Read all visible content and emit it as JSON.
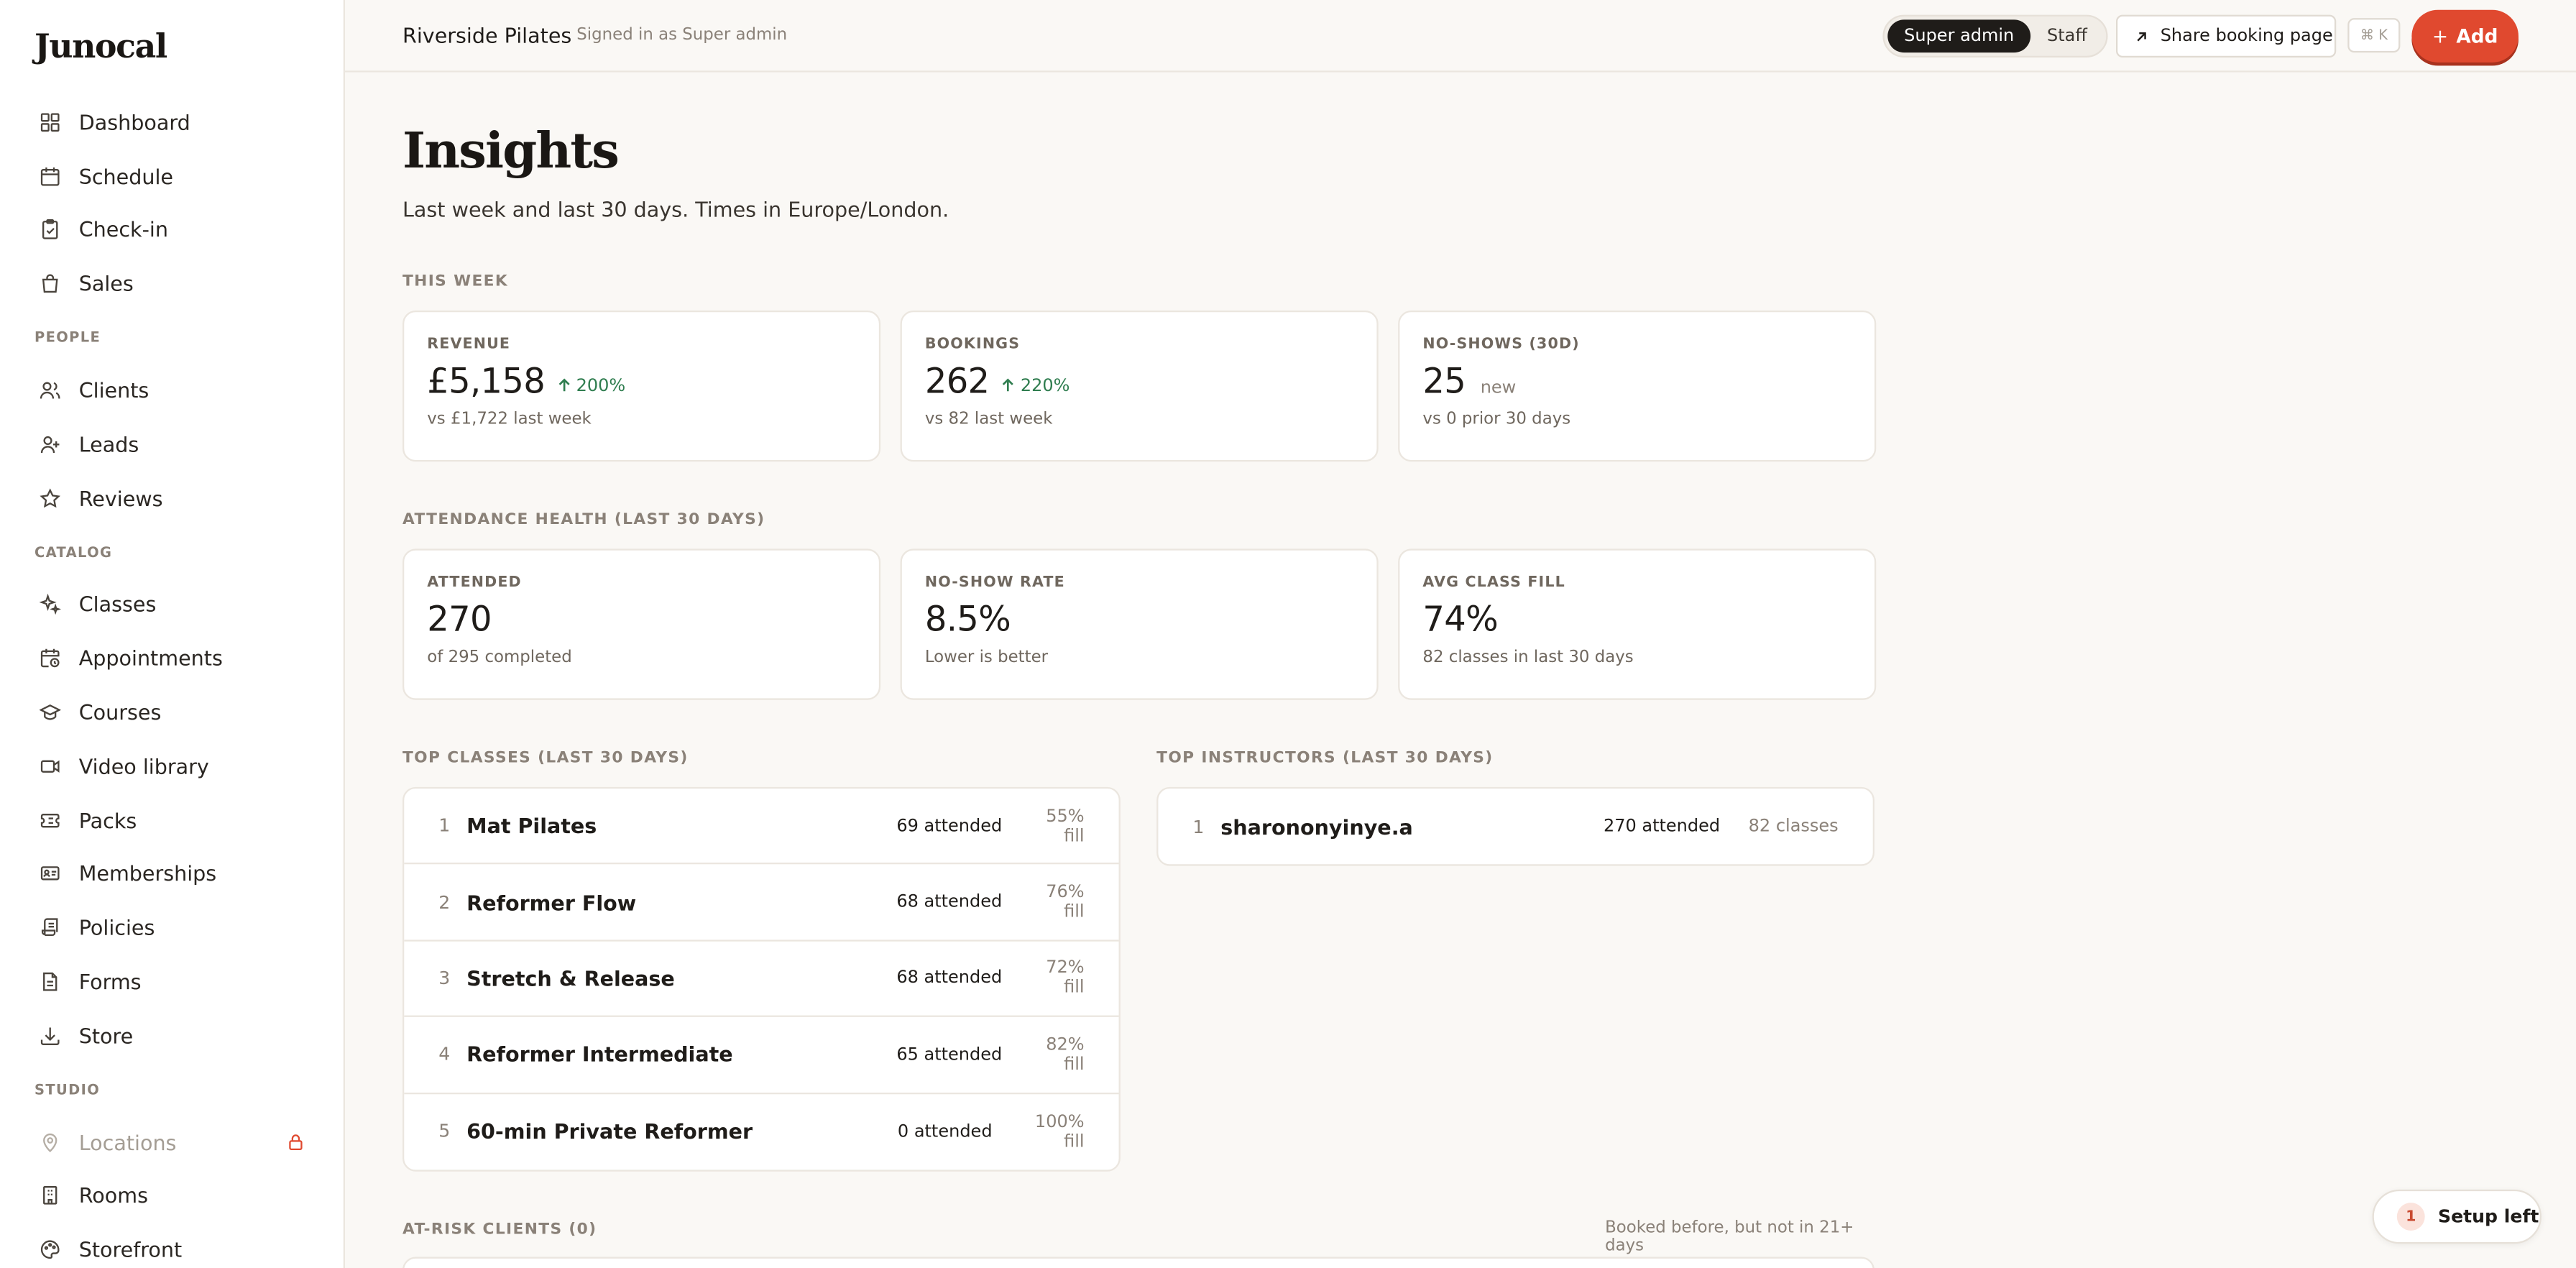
{
  "app": {
    "logo": "Junocal"
  },
  "sidebar": {
    "items_main": [
      {
        "label": "Dashboard",
        "icon": "dashboard-icon"
      },
      {
        "label": "Schedule",
        "icon": "calendar-icon"
      },
      {
        "label": "Check-in",
        "icon": "clipboard-check-icon"
      },
      {
        "label": "Sales",
        "icon": "shopping-bag-icon"
      }
    ],
    "section_people": "PEOPLE",
    "items_people": [
      {
        "label": "Clients",
        "icon": "users-icon"
      },
      {
        "label": "Leads",
        "icon": "user-plus-icon"
      },
      {
        "label": "Reviews",
        "icon": "star-icon"
      }
    ],
    "section_catalog": "CATALOG",
    "items_catalog": [
      {
        "label": "Classes",
        "icon": "sparkles-icon"
      },
      {
        "label": "Appointments",
        "icon": "calendar-clock-icon"
      },
      {
        "label": "Courses",
        "icon": "graduation-cap-icon"
      },
      {
        "label": "Video library",
        "icon": "video-icon"
      },
      {
        "label": "Packs",
        "icon": "ticket-icon"
      },
      {
        "label": "Memberships",
        "icon": "id-card-icon"
      },
      {
        "label": "Policies",
        "icon": "scroll-icon"
      },
      {
        "label": "Forms",
        "icon": "file-text-icon"
      },
      {
        "label": "Store",
        "icon": "download-icon"
      }
    ],
    "section_studio": "STUDIO",
    "items_studio": [
      {
        "label": "Locations",
        "icon": "map-pin-icon"
      },
      {
        "label": "Rooms",
        "icon": "building-icon"
      },
      {
        "label": "Storefront",
        "icon": "palette-icon"
      }
    ]
  },
  "topbar": {
    "studio_name": "Riverside Pilates",
    "signed_in": "Signed in as Super admin",
    "role_super": "Super admin",
    "role_staff": "Staff",
    "share_label": "Share booking page",
    "shortcut": "⌘ K",
    "add_label": "Add",
    "add_prefix": "+"
  },
  "page": {
    "title": "Insights",
    "subtitle": "Last week and last 30 days. Times in Europe/London."
  },
  "this_week": {
    "label": "THIS WEEK",
    "cards": [
      {
        "label": "REVENUE",
        "value": "£5,158",
        "delta": "200%",
        "sub": "vs £1,722 last week"
      },
      {
        "label": "BOOKINGS",
        "value": "262",
        "delta": "220%",
        "sub": "vs 82 last week"
      },
      {
        "label": "NO-SHOWS (30D)",
        "value": "25",
        "tag": "new",
        "sub": "vs 0 prior 30 days"
      }
    ]
  },
  "attendance": {
    "label": "ATTENDANCE HEALTH (LAST 30 DAYS)",
    "cards": [
      {
        "label": "ATTENDED",
        "value": "270",
        "sub": "of 295 completed"
      },
      {
        "label": "NO-SHOW RATE",
        "value": "8.5%",
        "sub": "Lower is better"
      },
      {
        "label": "AVG CLASS FILL",
        "value": "74%",
        "sub": "82 classes in last 30 days"
      }
    ]
  },
  "top_classes": {
    "label": "TOP CLASSES (LAST 30 DAYS)",
    "rows": [
      {
        "rank": "1",
        "name": "Mat Pilates",
        "attended": "69 attended",
        "fill": "55% fill"
      },
      {
        "rank": "2",
        "name": "Reformer Flow",
        "attended": "68 attended",
        "fill": "76% fill"
      },
      {
        "rank": "3",
        "name": "Stretch & Release",
        "attended": "68 attended",
        "fill": "72% fill"
      },
      {
        "rank": "4",
        "name": "Reformer Intermediate",
        "attended": "65 attended",
        "fill": "82% fill"
      },
      {
        "rank": "5",
        "name": "60-min Private Reformer",
        "attended": "0 attended",
        "fill": "100% fill"
      }
    ]
  },
  "top_instructors": {
    "label": "TOP INSTRUCTORS (LAST 30 DAYS)",
    "rows": [
      {
        "rank": "1",
        "name": "sharononyinye.a",
        "attended": "270 attended",
        "classes": "82 classes"
      }
    ]
  },
  "at_risk": {
    "label": "AT-RISK CLIENTS (0)",
    "note": "Booked before, but not in 21+ days"
  },
  "setup": {
    "count": "1",
    "label": "Setup left"
  },
  "colors": {
    "accent": "#e0492f",
    "positive": "#2f7d4f",
    "background": "#faf8f5"
  }
}
